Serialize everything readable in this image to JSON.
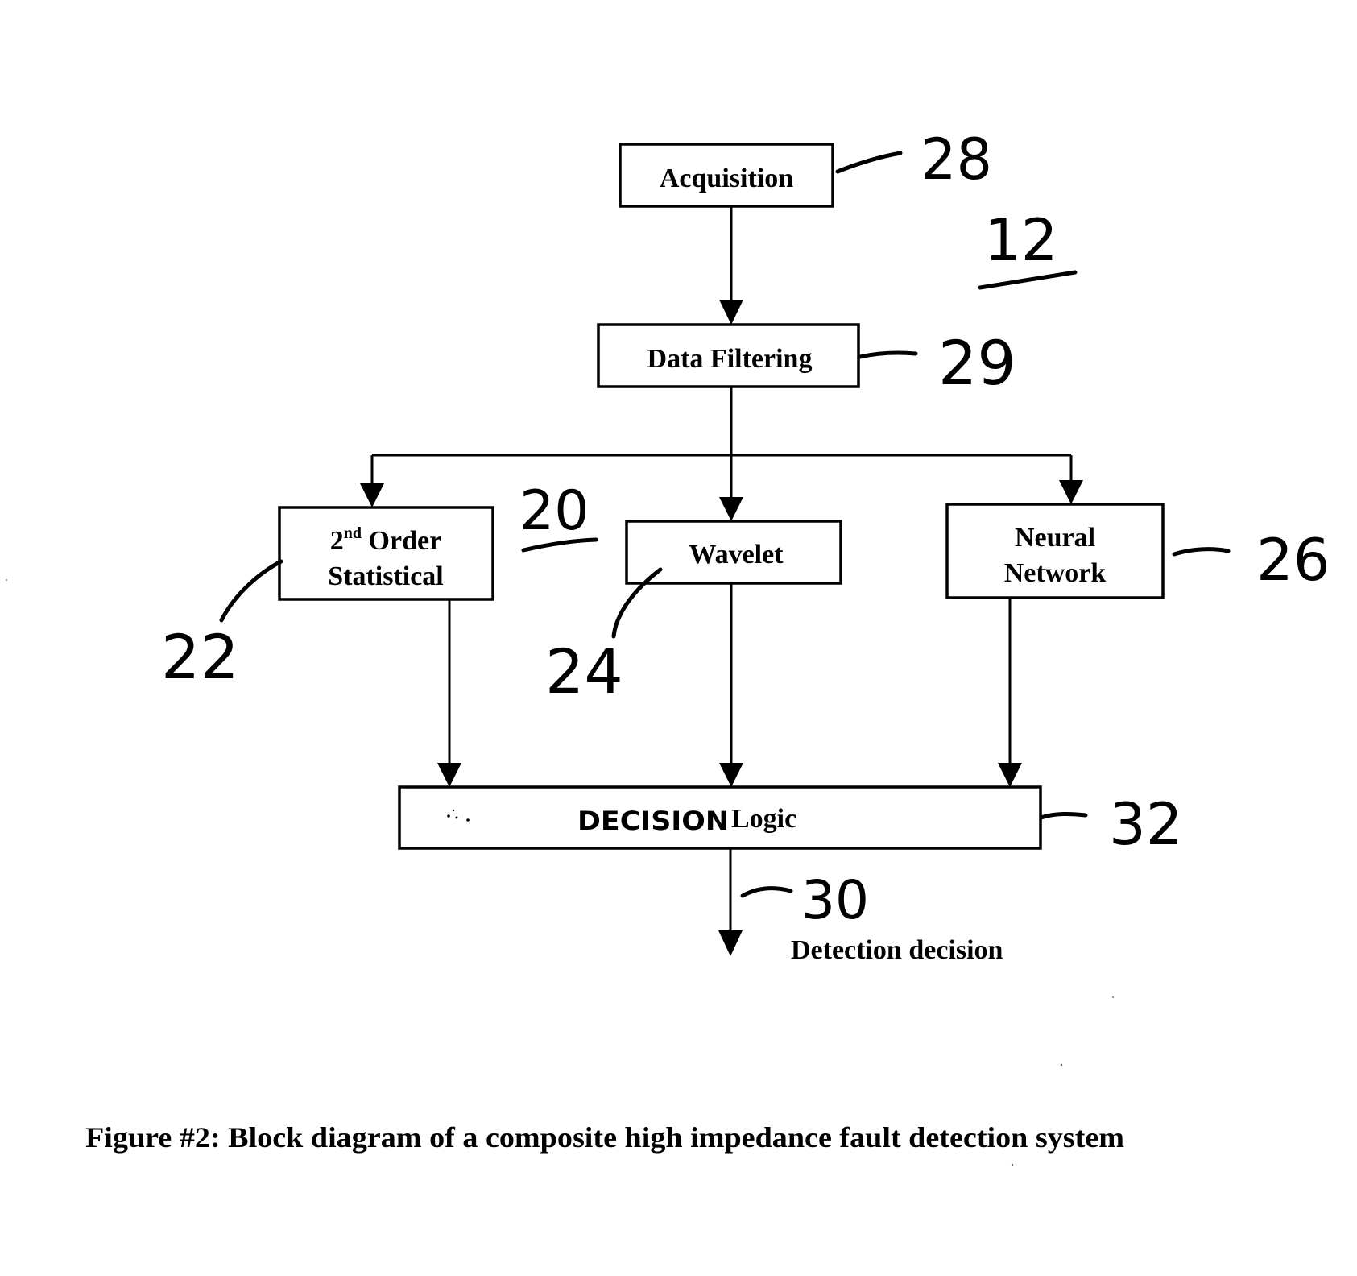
{
  "figure": {
    "caption": "Figure #2: Block diagram of a composite high impedance fault detection system",
    "system_reference": "12"
  },
  "blocks": {
    "acquisition": {
      "label": "Acquisition",
      "ref": "28"
    },
    "data_filtering": {
      "label": "Data Filtering",
      "ref": "29"
    },
    "second_order": {
      "label_base": "2",
      "label_sup": "nd",
      "label_line1_rest": " Order",
      "label_line2": "Statistical",
      "ref": "22"
    },
    "wavelet": {
      "label": "Wavelet",
      "ref": "24"
    },
    "neural_network": {
      "label_line1": "Neural",
      "label_line2": "Network",
      "ref": "26"
    },
    "decision_logic": {
      "label_handwritten": "DECISION",
      "label_printed": "Logic",
      "ref": "32"
    }
  },
  "group_ref": "20",
  "output": {
    "label": "Detection decision",
    "ref": "30"
  },
  "connections": [
    {
      "from": "acquisition",
      "to": "data_filtering"
    },
    {
      "from": "data_filtering",
      "to": "second_order"
    },
    {
      "from": "data_filtering",
      "to": "wavelet"
    },
    {
      "from": "data_filtering",
      "to": "neural_network"
    },
    {
      "from": "second_order",
      "to": "decision_logic"
    },
    {
      "from": "wavelet",
      "to": "decision_logic"
    },
    {
      "from": "neural_network",
      "to": "decision_logic"
    },
    {
      "from": "decision_logic",
      "to": "output"
    }
  ]
}
